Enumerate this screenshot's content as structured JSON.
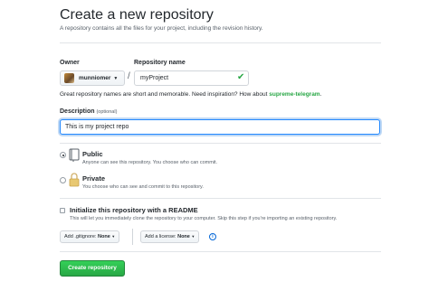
{
  "header": {
    "title": "Create a new repository",
    "subtitle": "A repository contains all the files for your project, including the revision history."
  },
  "owner": {
    "label": "Owner",
    "value": "munniomer"
  },
  "repository": {
    "label": "Repository name",
    "value": "myProject",
    "separator": "/"
  },
  "hint": {
    "text": "Great repository names are short and memorable. Need inspiration? How about ",
    "suggestion": "supreme-telegram",
    "end": "."
  },
  "description": {
    "label": "Description",
    "optional": "(optional)",
    "value": "This is my project repo"
  },
  "visibility": {
    "public": {
      "title": "Public",
      "desc": "Anyone can see this repository. You choose who can commit.",
      "selected": true
    },
    "private": {
      "title": "Private",
      "desc": "You choose who can see and commit to this repository.",
      "selected": false
    }
  },
  "readme": {
    "title": "Initialize this repository with a README",
    "desc": "This will let you immediately clone the repository to your computer. Skip this step if you're importing an existing repository.",
    "checked": false
  },
  "gitignore": {
    "prefix": "Add .gitignore:",
    "value": "None"
  },
  "license": {
    "prefix": "Add a license:",
    "value": "None"
  },
  "submit": {
    "label": "Create repository"
  },
  "colors": {
    "accent_green": "#28a745",
    "focus_blue": "#2188ff",
    "link_blue": "#0366d6"
  }
}
